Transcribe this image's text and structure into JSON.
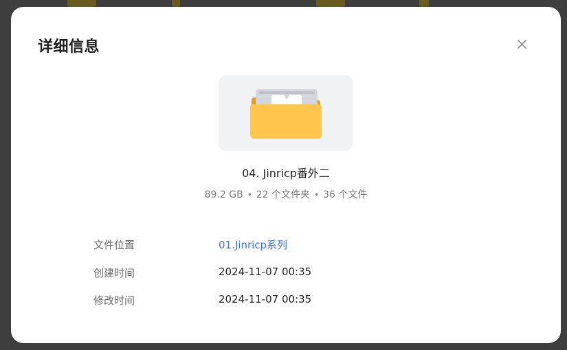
{
  "dialog": {
    "title": "详细信息",
    "close_icon": "close-icon"
  },
  "folder": {
    "icon": "folder-icon",
    "name": "04. Jinricp番外二",
    "size": "89.2 GB",
    "folder_count": "22 个文件夹",
    "file_count": "36 个文件",
    "separator": "•"
  },
  "details": [
    {
      "label": "文件位置",
      "value": "01.Jinricp系列"
    },
    {
      "label": "创建时间",
      "value": "2024-11-07 00:35"
    },
    {
      "label": "修改时间",
      "value": "2024-11-07 00:35"
    }
  ],
  "colors": {
    "link": "#3b76e0",
    "folder_yellow": "#ffc54d",
    "folder_back": "#e59b22"
  }
}
